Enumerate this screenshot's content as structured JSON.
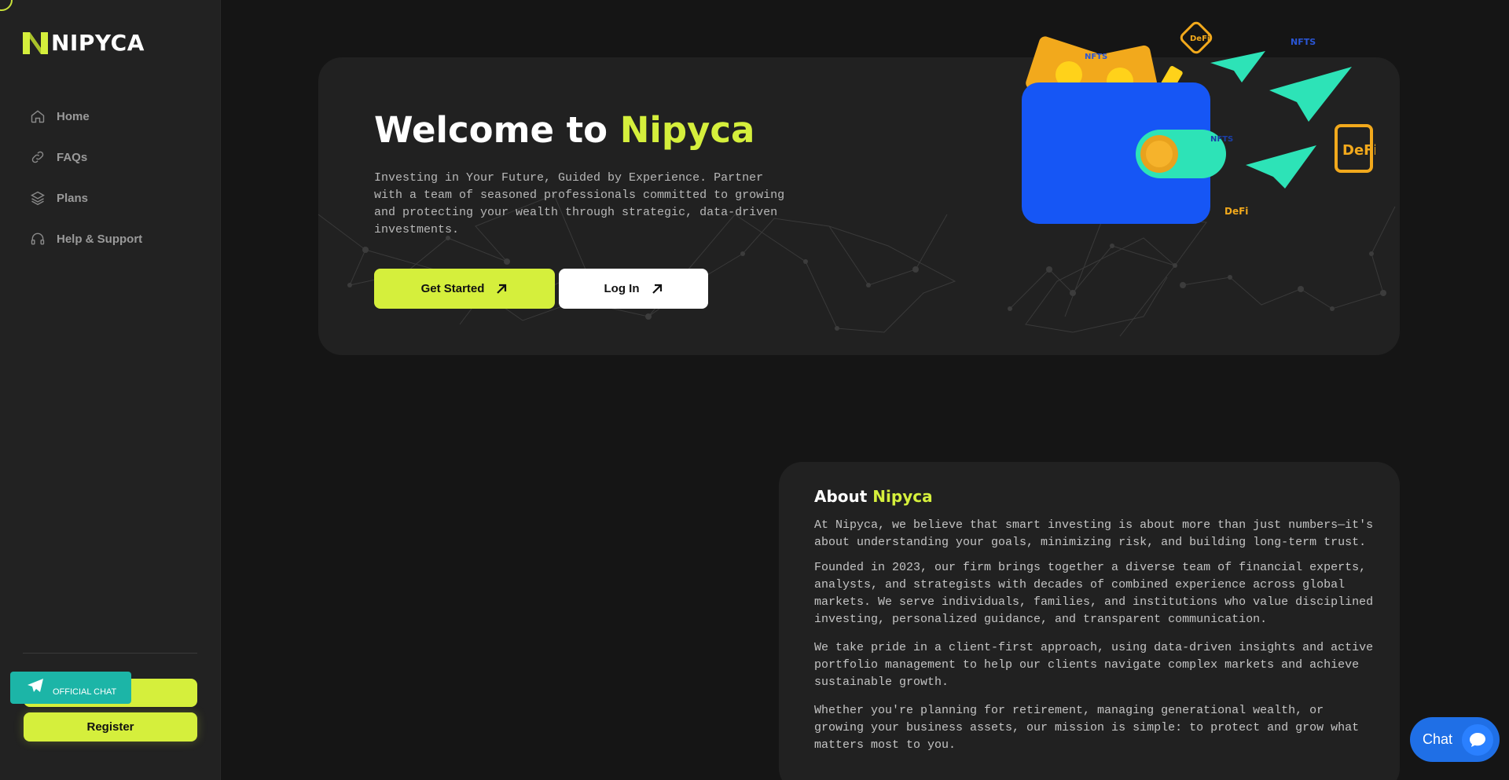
{
  "brand": {
    "name": "NIPYCA",
    "accent_color": "#d5ef3c"
  },
  "sidebar": {
    "items": [
      {
        "label": "Home",
        "icon": "home-icon"
      },
      {
        "label": "FAQs",
        "icon": "link-icon"
      },
      {
        "label": "Plans",
        "icon": "layers-icon"
      },
      {
        "label": "Help & Support",
        "icon": "headphones-icon"
      }
    ],
    "register_label": "Register",
    "official_chat_label": "OFFICIAL CHAT"
  },
  "hero": {
    "title_prefix": "Welcome to ",
    "title_accent": "Nipyca",
    "description": "Investing in Your Future, Guided by Experience. Partner with a team of seasoned professionals committed to growing and protecting your wealth through strategic, data-driven investments.",
    "get_started_label": "Get Started",
    "login_label": "Log In",
    "art_tags": [
      "DeFi",
      "NFTS",
      "DeFi",
      "DeFi",
      "NFTS",
      "NFTS"
    ]
  },
  "about": {
    "title_prefix": "About ",
    "title_accent": "Nipyca",
    "paragraphs": [
      "At Nipyca, we believe that smart investing is about more than just numbers—it's about understanding your goals, minimizing risk, and building long-term trust.",
      "Founded in 2023, our firm brings together a diverse team of financial experts, analysts, and strategists with decades of combined experience across global markets. We serve individuals, families, and institutions who value disciplined investing, personalized guidance, and transparent communication.",
      "We take pride in a client-first approach, using data-driven insights and active portfolio management to help our clients navigate complex markets and achieve sustainable growth.",
      "Whether you're planning for retirement, managing generational wealth, or growing your business assets, our mission is simple: to protect and grow what matters most to you."
    ]
  },
  "chat_widget": {
    "label": "Chat"
  }
}
